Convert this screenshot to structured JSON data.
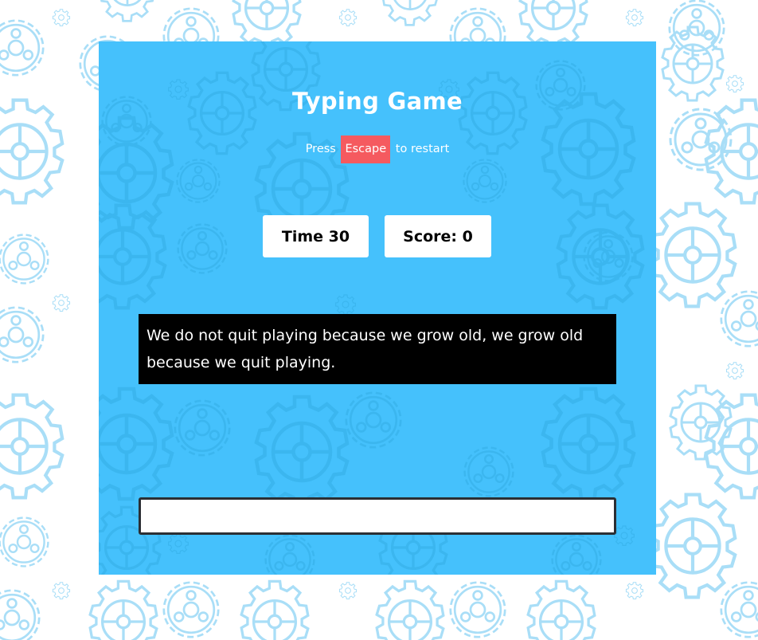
{
  "colors": {
    "page_background": "#ffffff",
    "pattern_light": "#a9def7",
    "panel_background": "#45c1fc",
    "panel_pattern": "#3bb6ef",
    "escape_key_background": "#f55a5f",
    "quote_background": "#000000",
    "input_border": "#2b2f34"
  },
  "game": {
    "title": "Typing Game",
    "hint_prefix": "Press",
    "hint_key": "Escape",
    "hint_suffix": "to restart",
    "time_label": "Time 30",
    "score_label": "Score: 0",
    "quote": "We do not quit playing because we grow old, we grow old because we quit playing.",
    "input_value": ""
  },
  "icons": {
    "background": "gear-icon"
  }
}
